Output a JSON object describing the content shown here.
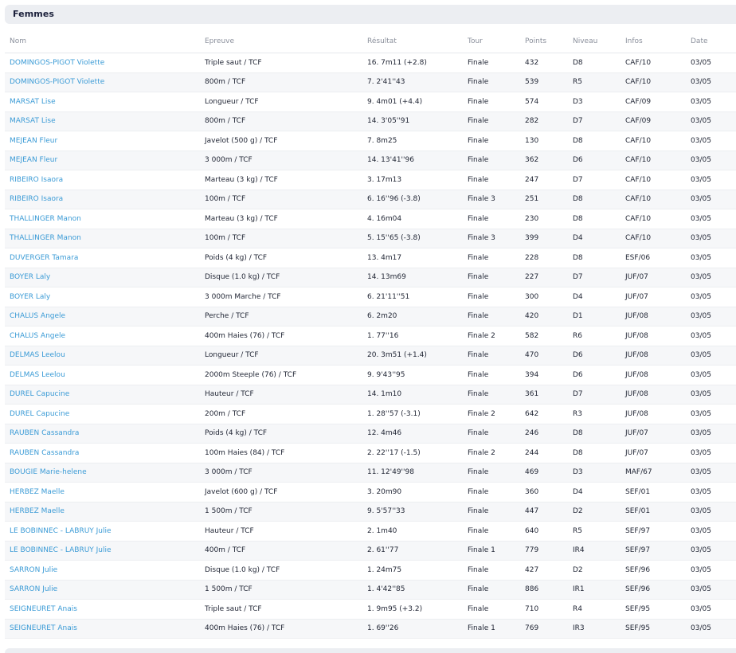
{
  "section": {
    "title": "Femmes"
  },
  "table": {
    "columns": [
      "Nom",
      "Epreuve",
      "Résultat",
      "Tour",
      "Points",
      "Niveau",
      "Infos",
      "Date"
    ],
    "rows": [
      [
        "DOMINGOS-PIGOT Violette",
        "Triple saut / TCF",
        "16. 7m11 (+2.8)",
        "Finale",
        "432",
        "D8",
        "CAF/10",
        "03/05"
      ],
      [
        "DOMINGOS-PIGOT Violette",
        "800m / TCF",
        "7. 2'41''43",
        "Finale",
        "539",
        "R5",
        "CAF/10",
        "03/05"
      ],
      [
        "MARSAT Lise",
        "Longueur / TCF",
        "9. 4m01 (+4.4)",
        "Finale",
        "574",
        "D3",
        "CAF/09",
        "03/05"
      ],
      [
        "MARSAT Lise",
        "800m / TCF",
        "14. 3'05''91",
        "Finale",
        "282",
        "D7",
        "CAF/09",
        "03/05"
      ],
      [
        "MEJEAN Fleur",
        "Javelot (500 g) / TCF",
        "7. 8m25",
        "Finale",
        "130",
        "D8",
        "CAF/10",
        "03/05"
      ],
      [
        "MEJEAN Fleur",
        "3 000m / TCF",
        "14. 13'41''96",
        "Finale",
        "362",
        "D6",
        "CAF/10",
        "03/05"
      ],
      [
        "RIBEIRO Isaora",
        "Marteau (3 kg) / TCF",
        "3. 17m13",
        "Finale",
        "247",
        "D7",
        "CAF/10",
        "03/05"
      ],
      [
        "RIBEIRO Isaora",
        "100m / TCF",
        "6. 16''96 (-3.8)",
        "Finale 3",
        "251",
        "D8",
        "CAF/10",
        "03/05"
      ],
      [
        "THALLINGER Manon",
        "Marteau (3 kg) / TCF",
        "4. 16m04",
        "Finale",
        "230",
        "D8",
        "CAF/10",
        "03/05"
      ],
      [
        "THALLINGER Manon",
        "100m / TCF",
        "5. 15''65 (-3.8)",
        "Finale 3",
        "399",
        "D4",
        "CAF/10",
        "03/05"
      ],
      [
        "DUVERGER Tamara",
        "Poids (4 kg) / TCF",
        "13. 4m17",
        "Finale",
        "228",
        "D8",
        "ESF/06",
        "03/05"
      ],
      [
        "BOYER Laly",
        "Disque (1.0 kg) / TCF",
        "14. 13m69",
        "Finale",
        "227",
        "D7",
        "JUF/07",
        "03/05"
      ],
      [
        "BOYER Laly",
        "3 000m Marche / TCF",
        "6. 21'11''51",
        "Finale",
        "300",
        "D4",
        "JUF/07",
        "03/05"
      ],
      [
        "CHALUS Angele",
        "Perche / TCF",
        "6. 2m20",
        "Finale",
        "420",
        "D1",
        "JUF/08",
        "03/05"
      ],
      [
        "CHALUS Angele",
        "400m Haies (76) / TCF",
        "1. 77''16",
        "Finale 2",
        "582",
        "R6",
        "JUF/08",
        "03/05"
      ],
      [
        "DELMAS Leelou",
        "Longueur / TCF",
        "20. 3m51 (+1.4)",
        "Finale",
        "470",
        "D6",
        "JUF/08",
        "03/05"
      ],
      [
        "DELMAS Leelou",
        "2000m Steeple (76) / TCF",
        "9. 9'43''95",
        "Finale",
        "394",
        "D6",
        "JUF/08",
        "03/05"
      ],
      [
        "DUREL Capucine",
        "Hauteur / TCF",
        "14. 1m10",
        "Finale",
        "361",
        "D7",
        "JUF/08",
        "03/05"
      ],
      [
        "DUREL Capucine",
        "200m / TCF",
        "1. 28''57 (-3.1)",
        "Finale 2",
        "642",
        "R3",
        "JUF/08",
        "03/05"
      ],
      [
        "RAUBEN Cassandra",
        "Poids (4 kg) / TCF",
        "12. 4m46",
        "Finale",
        "246",
        "D8",
        "JUF/07",
        "03/05"
      ],
      [
        "RAUBEN Cassandra",
        "100m Haies (84) / TCF",
        "2. 22''17 (-1.5)",
        "Finale 2",
        "244",
        "D8",
        "JUF/07",
        "03/05"
      ],
      [
        "BOUGIE Marie-helene",
        "3 000m / TCF",
        "11. 12'49''98",
        "Finale",
        "469",
        "D3",
        "MAF/67",
        "03/05"
      ],
      [
        "HERBEZ Maelle",
        "Javelot (600 g) / TCF",
        "3. 20m90",
        "Finale",
        "360",
        "D4",
        "SEF/01",
        "03/05"
      ],
      [
        "HERBEZ Maelle",
        "1 500m / TCF",
        "9. 5'57''33",
        "Finale",
        "447",
        "D2",
        "SEF/01",
        "03/05"
      ],
      [
        "LE BOBINNEC - LABRUY Julie",
        "Hauteur / TCF",
        "2. 1m40",
        "Finale",
        "640",
        "R5",
        "SEF/97",
        "03/05"
      ],
      [
        "LE BOBINNEC - LABRUY Julie",
        "400m / TCF",
        "2. 61''77",
        "Finale 1",
        "779",
        "IR4",
        "SEF/97",
        "03/05"
      ],
      [
        "SARRON Julie",
        "Disque (1.0 kg) / TCF",
        "1. 24m75",
        "Finale",
        "427",
        "D2",
        "SEF/96",
        "03/05"
      ],
      [
        "SARRON Julie",
        "1 500m / TCF",
        "1. 4'42''85",
        "Finale",
        "886",
        "IR1",
        "SEF/96",
        "03/05"
      ],
      [
        "SEIGNEURET Anais",
        "Triple saut / TCF",
        "1. 9m95 (+3.2)",
        "Finale",
        "710",
        "R4",
        "SEF/95",
        "03/05"
      ],
      [
        "SEIGNEURET Anais",
        "400m Haies (76) / TCF",
        "1. 69''26",
        "Finale 1",
        "769",
        "IR3",
        "SEF/95",
        "03/05"
      ]
    ]
  },
  "colors": {
    "link": "#3b9bd6",
    "header_bg": "#eceef2",
    "stripe": "#f6f7f9",
    "muted_text": "#8b909c"
  }
}
